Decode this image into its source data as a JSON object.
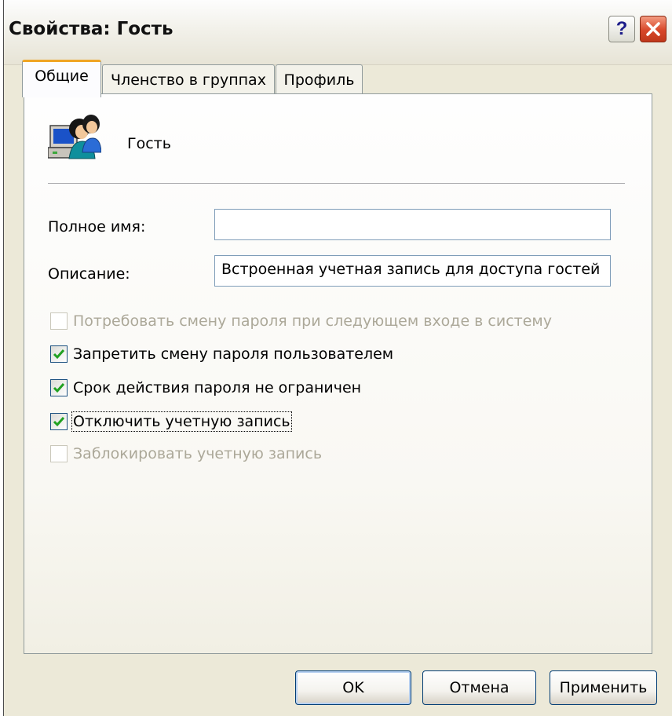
{
  "window": {
    "title": "Свойства: Гость",
    "help_label": "?"
  },
  "tabs": [
    {
      "label": "Общие",
      "active": true
    },
    {
      "label": "Членство в группах",
      "active": false
    },
    {
      "label": "Профиль",
      "active": false
    }
  ],
  "general": {
    "user_icon": "users-computer-icon",
    "user_name": "Гость",
    "full_name": {
      "label": "Полное имя:",
      "value": ""
    },
    "description": {
      "label": "Описание:",
      "value": "Встроенная учетная запись для доступа гостей"
    },
    "checkboxes": [
      {
        "label": "Потребовать смену пароля при следующем входе в систему",
        "checked": false,
        "disabled": true
      },
      {
        "label": "Запретить смену пароля пользователем",
        "checked": true,
        "disabled": false
      },
      {
        "label": "Срок действия пароля не ограничен",
        "checked": true,
        "disabled": false
      },
      {
        "label": "Отключить учетную запись",
        "checked": true,
        "disabled": false,
        "focused": true
      },
      {
        "label": "Заблокировать учетную запись",
        "checked": false,
        "disabled": true
      }
    ]
  },
  "buttons": {
    "ok": "OK",
    "cancel": "Отмена",
    "apply": "Применить"
  },
  "colors": {
    "dialog_bg": "#ece9d8",
    "active_tab_accent": "#f0a524",
    "checkmark": "#21a121",
    "close_button": "#d8472a"
  }
}
